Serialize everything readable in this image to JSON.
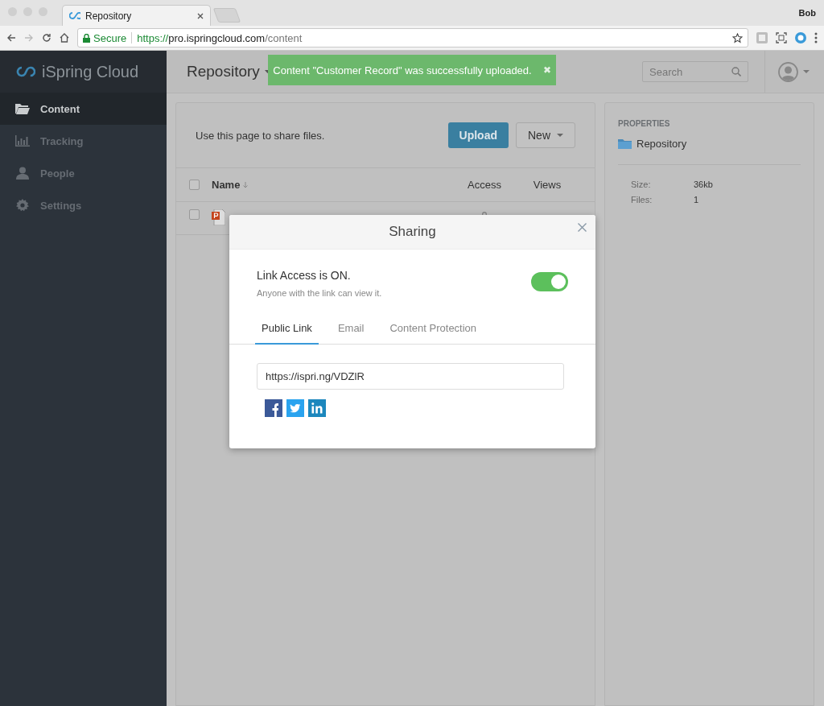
{
  "browser": {
    "tab_title": "Repository",
    "user": "Bob",
    "secure_label": "Secure",
    "url_scheme": "https://",
    "url_host": "pro.ispringcloud.com",
    "url_path": "/content"
  },
  "sidebar": {
    "logo": "iSpring Cloud",
    "items": [
      {
        "label": "Content",
        "selected": true
      },
      {
        "label": "Tracking",
        "selected": false
      },
      {
        "label": "People",
        "selected": false
      },
      {
        "label": "Settings",
        "selected": false
      }
    ]
  },
  "header": {
    "title": "Repository",
    "search": {
      "placeholder": "Search"
    }
  },
  "toast": {
    "message": "Content \"Customer Record\" was successfully uploaded.",
    "close": "✖"
  },
  "repository": {
    "hint": "Use this page to share files.",
    "buttons": [
      {
        "label": "Upload",
        "kind": "primary"
      },
      {
        "label": "New",
        "kind": "dropdown"
      }
    ],
    "all_checked": false,
    "columns": [
      "Name",
      "Access",
      "Views"
    ],
    "rows": [
      {
        "checked": false
      }
    ]
  },
  "properties": {
    "heading": "PROPERTIES",
    "folder": "Repository",
    "fields": [
      {
        "label": "Size:",
        "value": "36kb"
      },
      {
        "label": "Files:",
        "value": "1"
      }
    ]
  },
  "modal": {
    "title": "Sharing",
    "link_access": {
      "title": "Link Access is ON.",
      "subtitle": "Anyone with the link can view it.",
      "on": true
    },
    "tabs": [
      {
        "label": "Public Link",
        "selected": true
      },
      {
        "label": "Email",
        "selected": false
      },
      {
        "label": "Content Protection",
        "selected": false
      }
    ],
    "link": "https://ispri.ng/VDZlR",
    "social": [
      {
        "kind": "facebook"
      },
      {
        "kind": "twitter"
      },
      {
        "kind": "linkedin"
      }
    ]
  }
}
